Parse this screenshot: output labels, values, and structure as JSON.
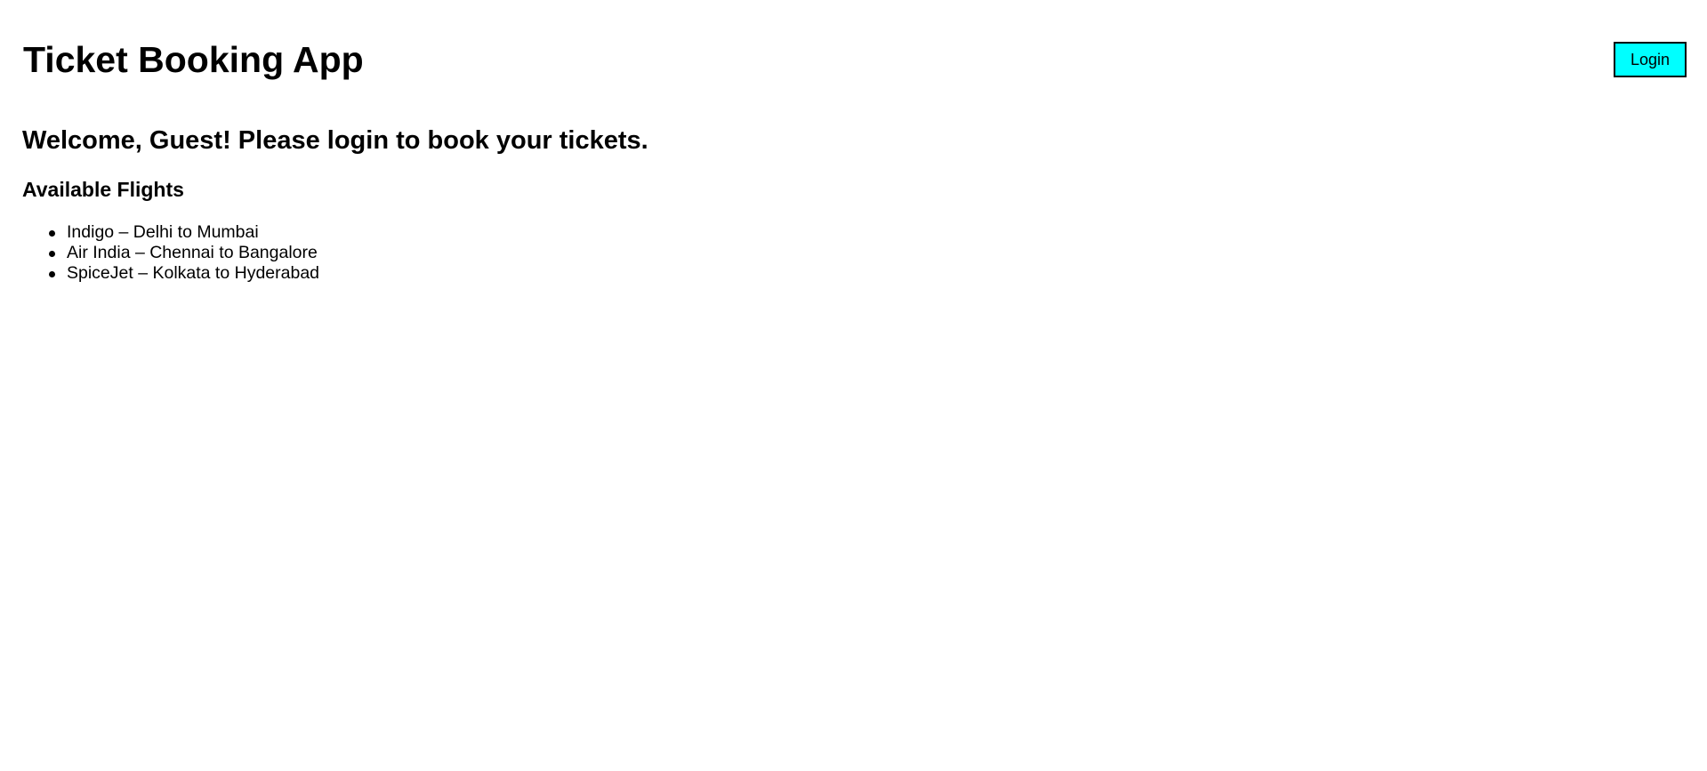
{
  "header": {
    "title": "Ticket Booking App",
    "login_label": "Login"
  },
  "main": {
    "welcome": "Welcome, Guest! Please login to book your tickets.",
    "flights_heading": "Available Flights",
    "flights": [
      "Indigo – Delhi to Mumbai",
      "Air India – Chennai to Bangalore",
      "SpiceJet – Kolkata to Hyderabad"
    ]
  },
  "colors": {
    "login_button_bg": "#00ffff",
    "text": "#000000",
    "background": "#ffffff"
  }
}
